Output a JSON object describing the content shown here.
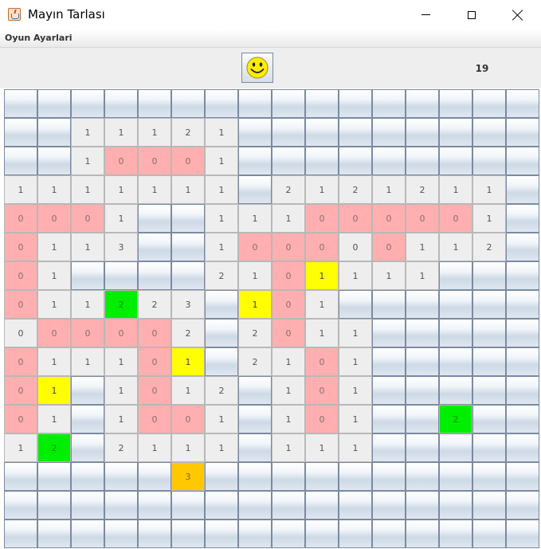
{
  "window": {
    "title": "Mayın Tarlası"
  },
  "menu": {
    "items": [
      "Oyun Ayarlari"
    ]
  },
  "toolbar": {
    "counter": "19"
  },
  "colors": {
    "revealed": "#eeeeee",
    "pink": "#ffafaf",
    "yellow": "#ffff00",
    "green": "#00ee00",
    "orange": "#ffc800"
  },
  "board": {
    "rows": [
      [
        "H",
        "H",
        "H",
        "H",
        "H",
        "H",
        "H",
        "H",
        "H",
        "H",
        "H",
        "H",
        "H",
        "H",
        "H",
        "H"
      ],
      [
        "H",
        "H",
        "r1",
        "r1",
        "r1",
        "r2",
        "r1",
        "H",
        "H",
        "H",
        "H",
        "H",
        "H",
        "H",
        "H",
        "H"
      ],
      [
        "H",
        "H",
        "r1",
        "p0",
        "p0",
        "p0",
        "r1",
        "H",
        "H",
        "H",
        "H",
        "H",
        "H",
        "H",
        "H",
        "H"
      ],
      [
        "r1",
        "r1",
        "r1",
        "r1",
        "r1",
        "r1",
        "r1",
        "H",
        "r2",
        "r1",
        "r2",
        "r1",
        "r2",
        "r1",
        "r1",
        "H"
      ],
      [
        "p0",
        "p0",
        "p0",
        "r1",
        "H",
        "H",
        "r1",
        "r1",
        "r1",
        "p0",
        "p0",
        "p0",
        "p0",
        "p0",
        "r1",
        "H"
      ],
      [
        "p0",
        "r1",
        "r1",
        "r3",
        "H",
        "H",
        "r1",
        "p0",
        "p0",
        "p0",
        "r0",
        "p0",
        "r1",
        "r1",
        "r2",
        "H"
      ],
      [
        "p0",
        "r1",
        "H",
        "H",
        "H",
        "H",
        "r2",
        "r1",
        "p0",
        "y1",
        "r1",
        "r1",
        "r1",
        "H",
        "H",
        "H"
      ],
      [
        "p0",
        "r1",
        "r1",
        "g2",
        "r2",
        "r3",
        "H",
        "y1",
        "p0",
        "r1",
        "H",
        "H",
        "H",
        "H",
        "H",
        "H"
      ],
      [
        "r0",
        "p0",
        "p0",
        "p0",
        "p0",
        "r2",
        "H",
        "r2",
        "p0",
        "r1",
        "r1",
        "H",
        "H",
        "H",
        "H",
        "H"
      ],
      [
        "p0",
        "r1",
        "r1",
        "r1",
        "p0",
        "y1",
        "H",
        "r2",
        "r1",
        "p0",
        "r1",
        "H",
        "H",
        "H",
        "H",
        "H"
      ],
      [
        "p0",
        "y1",
        "H",
        "r1",
        "p0",
        "r1",
        "r2",
        "H",
        "r1",
        "p0",
        "r1",
        "H",
        "H",
        "H",
        "H",
        "H"
      ],
      [
        "p0",
        "r1",
        "H",
        "r1",
        "p0",
        "p0",
        "r1",
        "H",
        "r1",
        "p0",
        "r1",
        "H",
        "H",
        "g2",
        "H",
        "H"
      ],
      [
        "r1",
        "g2",
        "H",
        "r2",
        "r1",
        "r1",
        "r1",
        "H",
        "r1",
        "r1",
        "r1",
        "H",
        "H",
        "H",
        "H",
        "H"
      ],
      [
        "H",
        "H",
        "H",
        "H",
        "H",
        "o3",
        "H",
        "H",
        "H",
        "H",
        "H",
        "H",
        "H",
        "H",
        "H",
        "H"
      ],
      [
        "H",
        "H",
        "H",
        "H",
        "H",
        "H",
        "H",
        "H",
        "H",
        "H",
        "H",
        "H",
        "H",
        "H",
        "H",
        "H"
      ],
      [
        "H",
        "H",
        "H",
        "H",
        "H",
        "H",
        "H",
        "H",
        "H",
        "H",
        "H",
        "H",
        "H",
        "H",
        "H",
        "H"
      ]
    ]
  }
}
